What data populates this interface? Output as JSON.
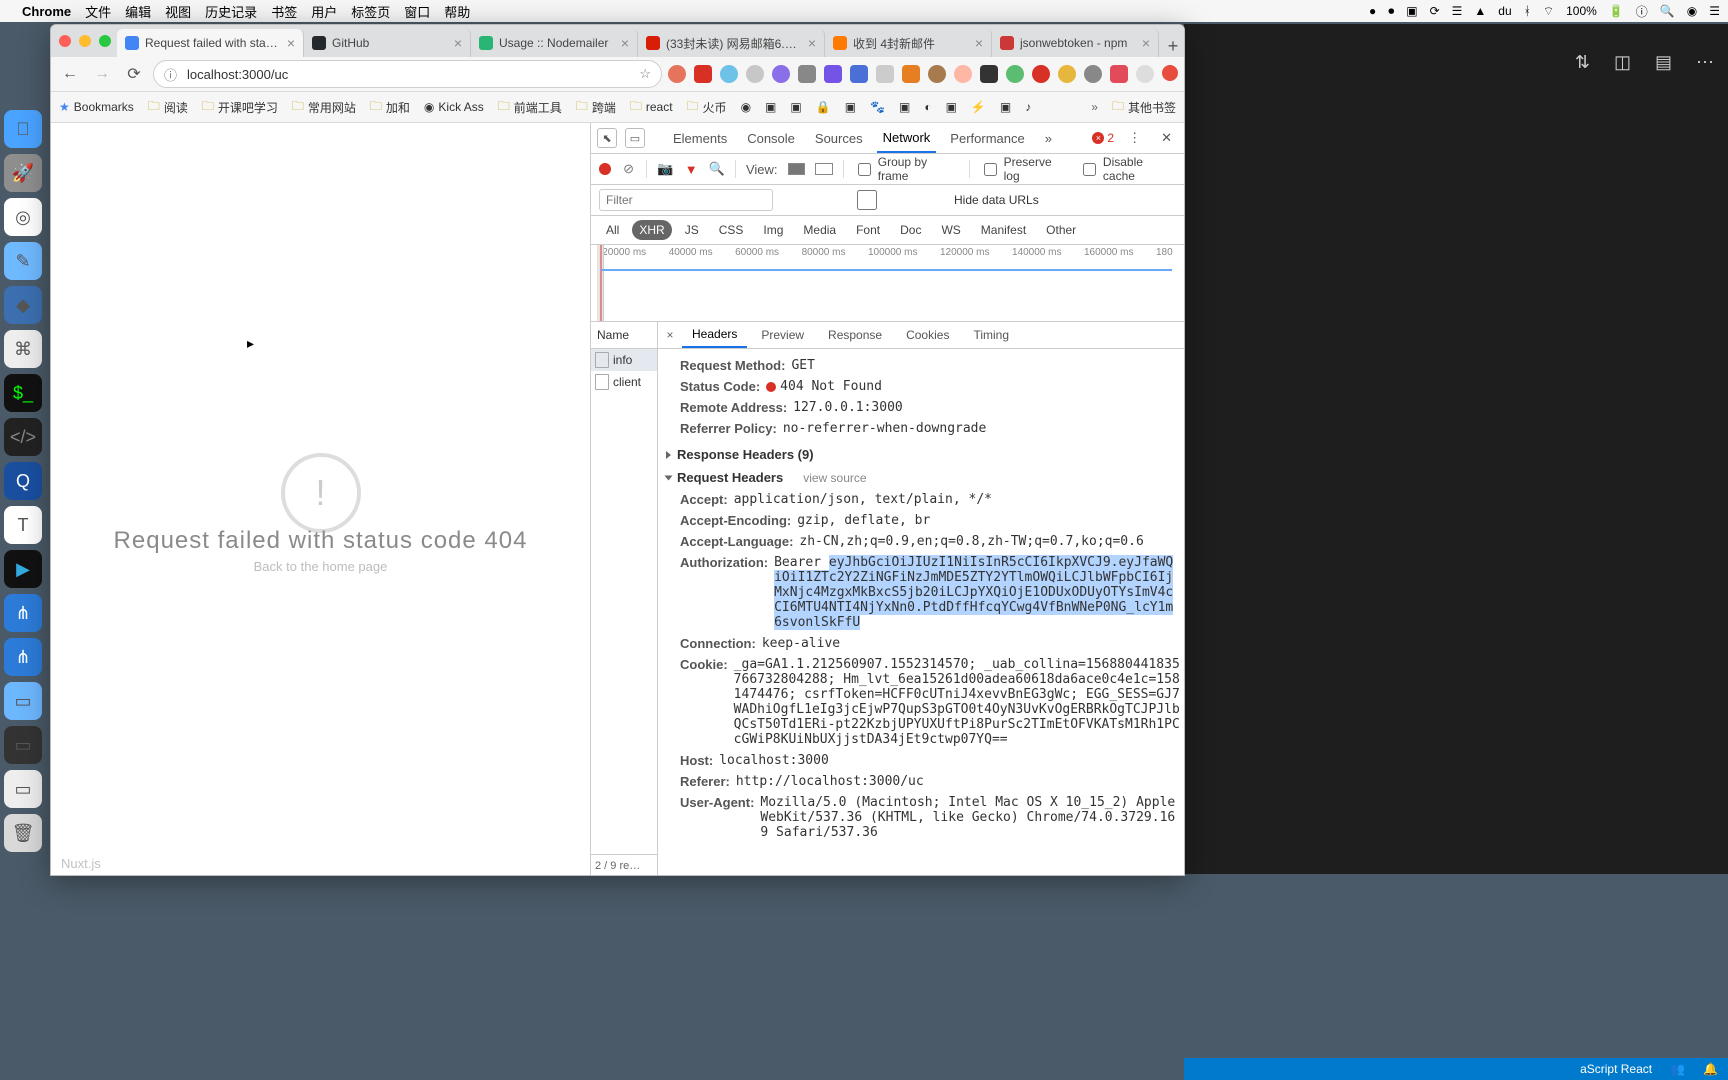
{
  "menubar": {
    "app": "Chrome",
    "items": [
      "文件",
      "编辑",
      "视图",
      "历史记录",
      "书签",
      "用户",
      "标签页",
      "窗口",
      "帮助"
    ],
    "right": {
      "battery": "100%",
      "batteryIcon": "🔋",
      "menuIcon": "☰"
    }
  },
  "tabs": [
    {
      "title": "Request failed with statu…",
      "active": true
    },
    {
      "title": "GitHub",
      "active": false
    },
    {
      "title": "Usage :: Nodemailer",
      "active": false
    },
    {
      "title": "(33封未读) 网易邮箱6.0…",
      "active": false
    },
    {
      "title": "收到 4封新邮件",
      "active": false
    },
    {
      "title": "jsonwebtoken - npm",
      "active": false
    }
  ],
  "newtab": "+",
  "omnibar": {
    "url": "localhost:3000/uc",
    "info": "ⓘ",
    "star": "☆"
  },
  "bookmarksbar": {
    "label": "Bookmarks",
    "items": [
      "阅读",
      "开课吧学习",
      "常用网站",
      "加和",
      "Kick Ass",
      "前端工具",
      "跨端",
      "react",
      "火币"
    ],
    "overflow": "»",
    "other": "其他书签"
  },
  "page": {
    "cursor": "▸",
    "icon": "!",
    "message": "Request failed with status code 404",
    "back": "Back to the home page",
    "brand": "Nuxt.js"
  },
  "devtools": {
    "tabs": [
      "Elements",
      "Console",
      "Sources",
      "Network",
      "Performance"
    ],
    "activeTab": "Network",
    "more": "»",
    "errors": "2",
    "gear": "⋮",
    "close": "✕",
    "toolbar": {
      "viewLabel": "View:",
      "group": "Group by frame",
      "preserve": "Preserve log",
      "disableCache": "Disable cache"
    },
    "filter": {
      "placeholder": "Filter",
      "hideUrls": "Hide data URLs"
    },
    "types": [
      "All",
      "XHR",
      "JS",
      "CSS",
      "Img",
      "Media",
      "Font",
      "Doc",
      "WS",
      "Manifest",
      "Other"
    ],
    "activeType": "XHR",
    "waterfallTicks": [
      "20000 ms",
      "40000 ms",
      "60000 ms",
      "80000 ms",
      "100000 ms",
      "120000 ms",
      "140000 ms",
      "160000 ms",
      "180"
    ],
    "names": {
      "header": "Name",
      "rows": [
        "info",
        "client"
      ],
      "footer": "2 / 9 re…"
    },
    "detailTabs": [
      "Headers",
      "Preview",
      "Response",
      "Cookies",
      "Timing"
    ],
    "activeDetailTab": "Headers",
    "headers": {
      "general": {
        "requestMethod": {
          "k": "Request Method:",
          "v": "GET"
        },
        "statusCode": {
          "k": "Status Code:",
          "v": "404 Not Found"
        },
        "remoteAddress": {
          "k": "Remote Address:",
          "v": "127.0.0.1:3000"
        },
        "referrerPolicy": {
          "k": "Referrer Policy:",
          "v": "no-referrer-when-downgrade"
        }
      },
      "responseSection": "Response Headers (9)",
      "requestSection": "Request Headers",
      "viewSource": "view source",
      "request": {
        "accept": {
          "k": "Accept:",
          "v": "application/json, text/plain, */*"
        },
        "acceptEncoding": {
          "k": "Accept-Encoding:",
          "v": "gzip, deflate, br"
        },
        "acceptLanguage": {
          "k": "Accept-Language:",
          "v": "zh-CN,zh;q=0.9,en;q=0.8,zh-TW;q=0.7,ko;q=0.6"
        },
        "authorization": {
          "k": "Authorization:",
          "prefix": "Bearer ",
          "token": "eyJhbGciOiJIUzI1NiIsInR5cCI6IkpXVCJ9.eyJfaWQiOiI1ZTc2Y2ZiNGFiNzJmMDE5ZTY2YTlmOWQiLCJlbWFpbCI6IjMxNjc4MzgxMkBxcS5jb20iLCJpYXQiOjE1ODUxODUyOTYsImV4cCI6MTU4NTI4NjYxNn0.PtdDffHfcqYCwg4VfBnWNeP0NG_lcY1m6svonlSkFfU"
        },
        "connection": {
          "k": "Connection:",
          "v": "keep-alive"
        },
        "cookie": {
          "k": "Cookie:",
          "v": "_ga=GA1.1.212560907.1552314570; _uab_collina=156880441835766732804288; Hm_lvt_6ea15261d00adea60618da6ace0c4e1c=1581474476; csrfToken=HCFF0cUTniJ4xevvBnEG3gWc; EGG_SESS=GJ7WADhiOgfL1eIg3jcEjwP7QupS3pGTO0t4OyN3UvKvOgERBRkOgTCJPJlbQCsT50Td1ERi-pt22KzbjUPYUXUftPi8PurSc2TImEtOFVKATsM1Rh1PCcGWiP8KUiNbUXjjstDA34jEt9ctwp07YQ=="
        },
        "host": {
          "k": "Host:",
          "v": "localhost:3000"
        },
        "referer": {
          "k": "Referer:",
          "v": "http://localhost:3000/uc"
        },
        "userAgent": {
          "k": "User-Agent:",
          "v": "Mozilla/5.0 (Macintosh; Intel Mac OS X 10_15_2) AppleWebKit/537.36 (KHTML, like Gecko) Chrome/74.0.3729.169 Safari/537.36"
        }
      }
    }
  },
  "vscodeStatus": {
    "lang": "aScript React",
    "people": "👥",
    "bell": "🔔"
  }
}
